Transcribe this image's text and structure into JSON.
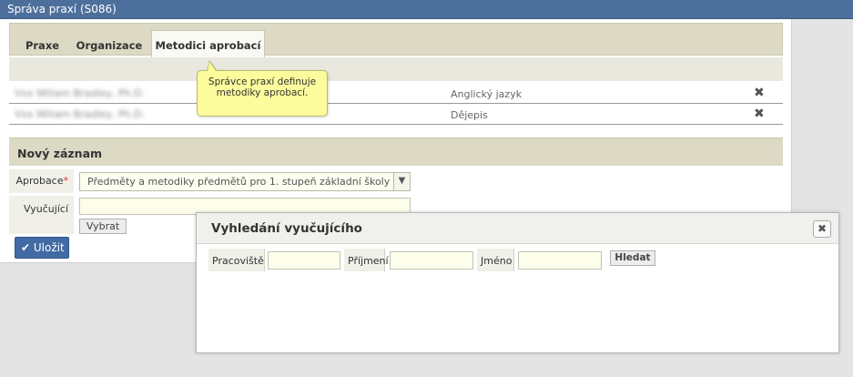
{
  "window": {
    "title": "Správa praxí (S086)"
  },
  "tabs": [
    {
      "label": "Praxe",
      "active": false
    },
    {
      "label": "Organizace",
      "active": false
    },
    {
      "label": "Metodici aprobací",
      "active": true
    }
  ],
  "methodists": [
    {
      "name": "Vxx Wiliam Bradley, Ph.D.",
      "subject": "Anglický jazyk",
      "delete_icon": "✖"
    },
    {
      "name": "Vxx Wiliam Bradley, Ph.D.",
      "subject": "Dějepis",
      "delete_icon": "✖"
    }
  ],
  "tooltip": {
    "text": "Správce praxí definuje metodiky aprobací."
  },
  "new_record": {
    "title": "Nový záznam",
    "aprobace_label": "Aprobace",
    "required_mark": "*",
    "aprobace_value": "Předměty a metodiky předmětů pro 1. stupeň základní školy",
    "vyucujici_label": "Vyučující",
    "vyucujici_value": "",
    "vybrat_label": "Vybrat",
    "save_label": "Uložit",
    "save_icon": "check-icon"
  },
  "dialog": {
    "title": "Vyhledání vyučujícího",
    "close_icon": "✖",
    "fields": [
      {
        "label": "Pracoviště",
        "value": ""
      },
      {
        "label": "Příjmení",
        "value": ""
      },
      {
        "label": "Jméno",
        "value": ""
      }
    ],
    "search_label": "Hledat"
  },
  "colors": {
    "titlebar": "#4d6f9c",
    "tab_bg": "#dcd9c5",
    "save_button": "#426aa3",
    "tooltip": "#fcfc9c",
    "input_bg": "#fdfdeb"
  }
}
